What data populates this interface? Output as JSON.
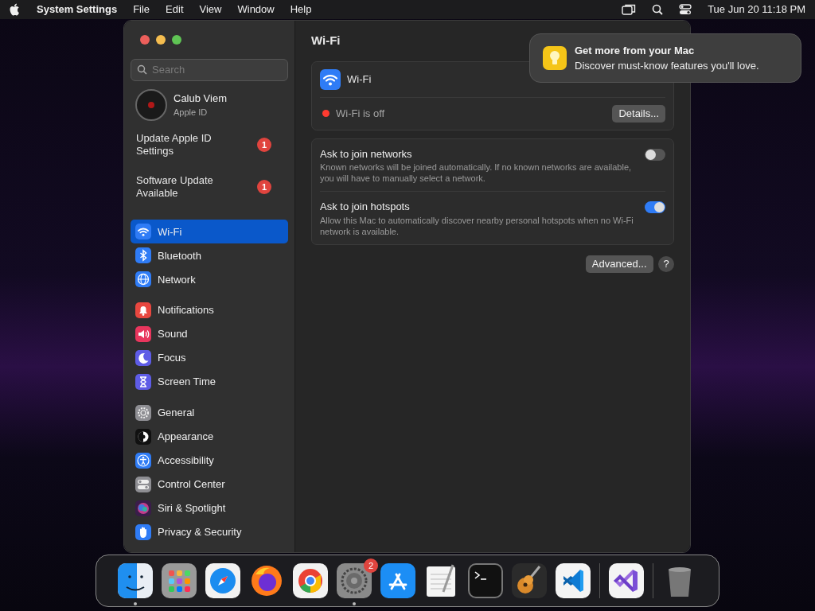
{
  "menubar": {
    "app": "System Settings",
    "menus": [
      "File",
      "Edit",
      "View",
      "Window",
      "Help"
    ],
    "clock": "Tue Jun 20  11:18 PM"
  },
  "sidebar": {
    "search": {
      "placeholder": "Search"
    },
    "account": {
      "name": "Calub Viem",
      "subtitle": "Apple ID"
    },
    "alerts": [
      {
        "label": "Update Apple ID Settings",
        "badge": "1"
      },
      {
        "label": "Software Update Available",
        "badge": "1"
      }
    ],
    "groups": [
      [
        {
          "label": "Wi-Fi",
          "kind": "wifi",
          "selected": true
        },
        {
          "label": "Bluetooth",
          "kind": "bluetooth",
          "selected": false
        },
        {
          "label": "Network",
          "kind": "globe",
          "selected": false
        }
      ],
      [
        {
          "label": "Notifications",
          "kind": "bell",
          "selected": false
        },
        {
          "label": "Sound",
          "kind": "speaker",
          "selected": false
        },
        {
          "label": "Focus",
          "kind": "moon",
          "selected": false
        },
        {
          "label": "Screen Time",
          "kind": "hourglass",
          "selected": false
        }
      ],
      [
        {
          "label": "General",
          "kind": "gear",
          "selected": false
        },
        {
          "label": "Appearance",
          "kind": "contrast",
          "selected": false
        },
        {
          "label": "Accessibility",
          "kind": "person",
          "selected": false
        },
        {
          "label": "Control Center",
          "kind": "switches",
          "selected": false
        },
        {
          "label": "Siri & Spotlight",
          "kind": "orb",
          "selected": false
        },
        {
          "label": "Privacy & Security",
          "kind": "hand",
          "selected": false
        }
      ]
    ]
  },
  "content": {
    "title": "Wi-Fi",
    "wifi": {
      "label": "Wi-Fi",
      "on": false,
      "status": "Wi-Fi is off",
      "details_button": "Details..."
    },
    "options": [
      {
        "title": "Ask to join networks",
        "description": "Known networks will be joined automatically. If no known networks are available, you will have to manually select a network.",
        "on": false
      },
      {
        "title": "Ask to join hotspots",
        "description": "Allow this Mac to automatically discover nearby personal hotspots when no Wi-Fi network is available.",
        "on": true
      }
    ],
    "advanced_button": "Advanced...",
    "help_button": "?"
  },
  "notification": {
    "title": "Get more from your Mac",
    "message": "Discover must-know features you'll love."
  },
  "dock": [
    {
      "kind": "finder",
      "running": true
    },
    {
      "kind": "launchpad",
      "running": false
    },
    {
      "kind": "safari",
      "running": false
    },
    {
      "kind": "firefox",
      "running": false
    },
    {
      "kind": "chrome",
      "running": false
    },
    {
      "kind": "settings",
      "running": true,
      "badge": "2"
    },
    {
      "kind": "appstore",
      "running": false
    },
    {
      "kind": "textedit",
      "running": false
    },
    {
      "kind": "terminal",
      "running": false
    },
    {
      "kind": "garageband",
      "running": false
    },
    {
      "kind": "vscode",
      "running": false
    },
    {
      "kind": "separator"
    },
    {
      "kind": "vs",
      "running": false
    },
    {
      "kind": "separator"
    },
    {
      "kind": "trash",
      "running": false
    }
  ]
}
